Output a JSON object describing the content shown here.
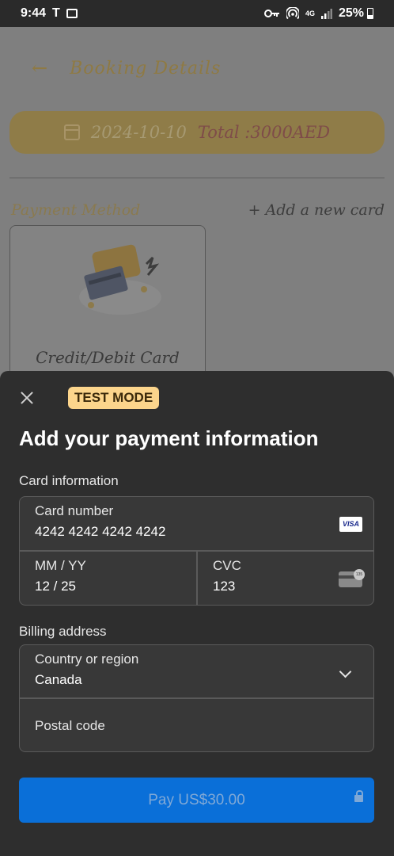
{
  "status_bar": {
    "time": "9:44",
    "t_icon": "T",
    "image_icon": "image-icon",
    "icons": [
      "key-icon",
      "hotspot-icon",
      "4g-icon",
      "signal-icon"
    ],
    "network_label": "4G",
    "battery": "25%"
  },
  "background": {
    "back_icon": "back-arrow-icon",
    "title": "Booking Details",
    "date": "2024-10-10",
    "total": "Total :3000AED",
    "payment_method_label": "Payment Method",
    "add_card_label": "+ Add a new card",
    "card_option_label": "Credit/Debit Card",
    "colors": {
      "accent": "#f5b942"
    }
  },
  "sheet": {
    "close_icon": "close-icon",
    "badge": "TEST MODE",
    "title": "Add your payment information",
    "card_section_label": "Card information",
    "card_number_label": "Card number",
    "card_number_value": "4242 4242 4242 4242",
    "card_brand": "VISA",
    "expiry_label": "MM / YY",
    "expiry_value": "12 / 25",
    "cvc_label": "CVC",
    "cvc_value": "123",
    "billing_section_label": "Billing address",
    "country_label": "Country or region",
    "country_value": "Canada",
    "postal_label": "Postal code",
    "pay_button_label": "Pay US$30.00",
    "colors": {
      "pay_button": "#0a6fd8",
      "badge": "#fcd58c",
      "sheet_bg": "#2e2e2e"
    }
  }
}
